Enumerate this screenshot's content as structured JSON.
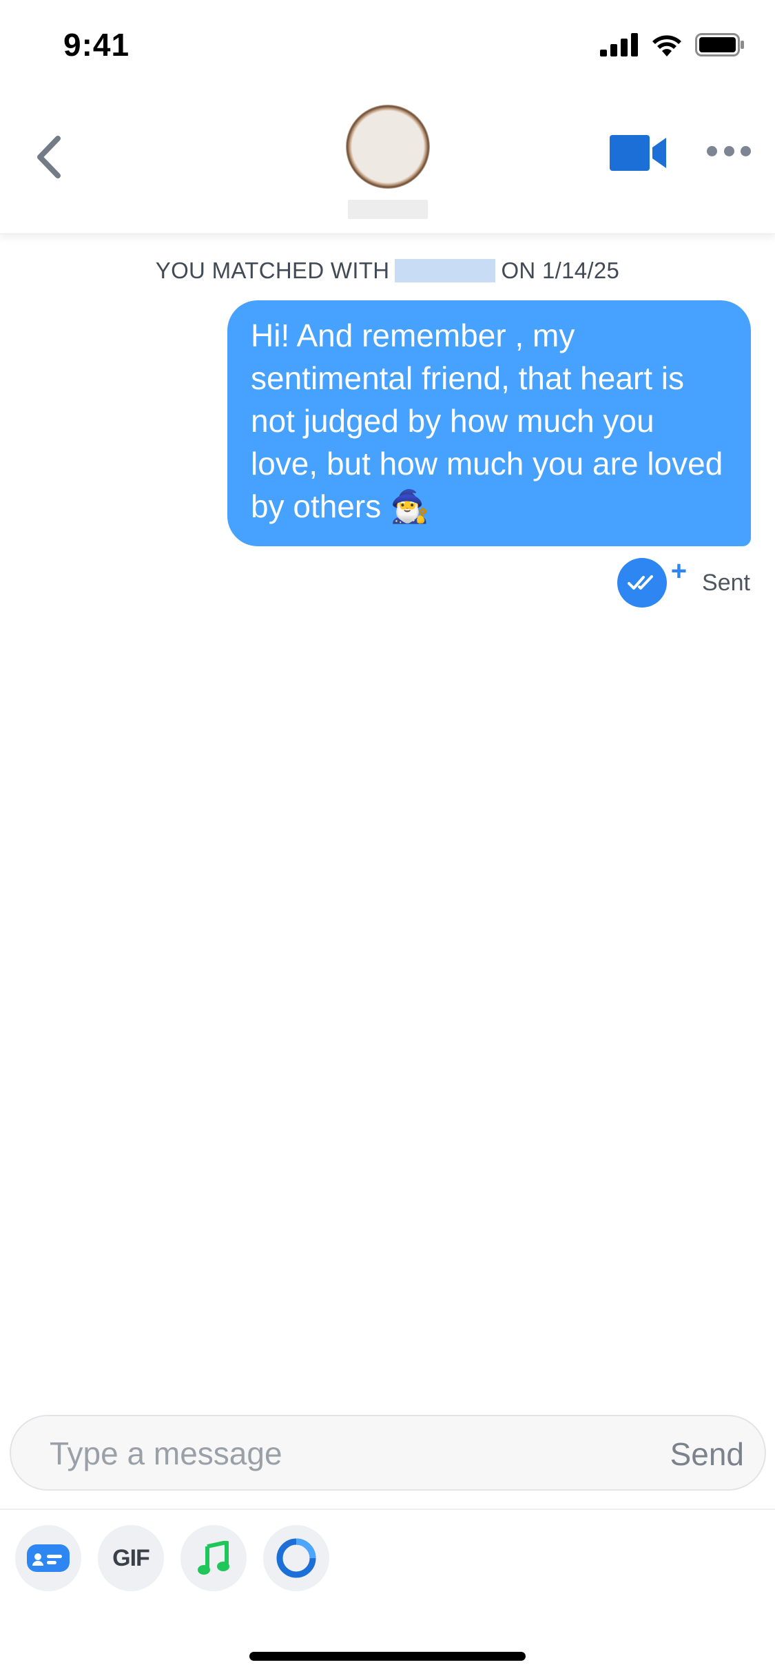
{
  "status_bar": {
    "time": "9:41",
    "icons": [
      "cellular-signal-icon",
      "wifi-icon",
      "battery-icon"
    ]
  },
  "header": {
    "back_icon": "chevron-left-icon",
    "video_icon": "video-camera-icon",
    "more_icon": "more-horizontal-icon"
  },
  "conversation": {
    "matched_prefix": "YOU MATCHED WITH",
    "matched_suffix": "ON 1/14/25",
    "messages": [
      {
        "direction": "outgoing",
        "text": "Hi! And remember , my sentimental friend, that heart is not judged by how much you love, but how much you are loved by others 🧙‍♂️",
        "status": "Sent"
      }
    ]
  },
  "composer": {
    "placeholder": "Type a message",
    "send_label": "Send"
  },
  "toolbar": {
    "gif_label": "GIF",
    "items": [
      "sticker-card-icon",
      "gif-button",
      "music-note-icon",
      "ring-icon"
    ]
  },
  "colors": {
    "bubble": "#47a1ff",
    "accent": "#2e86f2",
    "video": "#1b6fd6",
    "music": "#1fc75a"
  }
}
